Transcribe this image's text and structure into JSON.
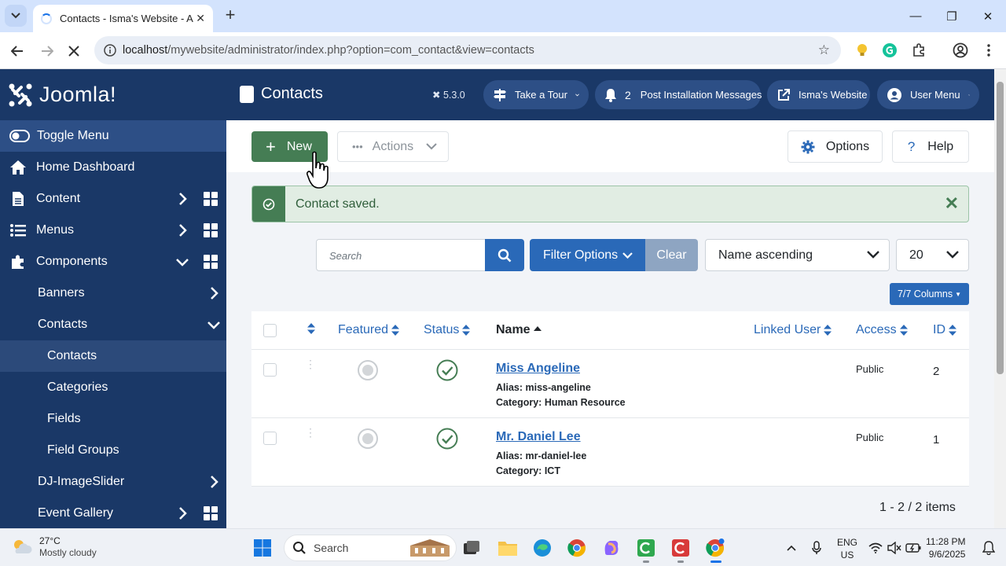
{
  "browser": {
    "tab_title": "Contacts - Isma's Website - Administration",
    "url_host": "localhost",
    "url_path": "/mywebsite/administrator/index.php?option=com_contact&view=contacts"
  },
  "sidebar": {
    "brand": "Joomla!",
    "toggle_label": "Toggle Menu",
    "items": [
      {
        "label": "Home Dashboard"
      },
      {
        "label": "Content"
      },
      {
        "label": "Menus"
      },
      {
        "label": "Components"
      },
      {
        "label": "Banners"
      },
      {
        "label": "Contacts"
      },
      {
        "label": "Contacts"
      },
      {
        "label": "Categories"
      },
      {
        "label": "Fields"
      },
      {
        "label": "Field Groups"
      },
      {
        "label": "DJ-ImageSlider"
      },
      {
        "label": "Event Gallery"
      }
    ]
  },
  "header": {
    "title": "Contacts",
    "version": "5.3.0",
    "tour_label": "Take a Tour",
    "messages_count": "2",
    "messages_label": "Post Installation Messages",
    "site_label": "Isma's Website",
    "user_label": "User Menu"
  },
  "toolbar": {
    "new_label": "New",
    "actions_label": "Actions",
    "options_label": "Options",
    "help_label": "Help"
  },
  "alert": {
    "message": "Contact saved."
  },
  "filters": {
    "search_placeholder": "Search",
    "filter_label": "Filter Options",
    "clear_label": "Clear",
    "sort_value": "Name ascending",
    "limit_value": "20",
    "columns_label": "7/7 Columns"
  },
  "table": {
    "headers": {
      "featured": "Featured",
      "status": "Status",
      "name": "Name",
      "linked_user": "Linked User",
      "access": "Access",
      "id": "ID"
    },
    "rows": [
      {
        "name": "Miss Angeline",
        "alias": "Alias: miss-angeline",
        "category": "Category: Human Resource",
        "access": "Public",
        "id": "2"
      },
      {
        "name": "Mr. Daniel Lee",
        "alias": "Alias: mr-daniel-lee",
        "category": "Category: ICT",
        "access": "Public",
        "id": "1"
      }
    ],
    "pagination": "1 - 2 / 2 items"
  },
  "taskbar": {
    "temperature": "27°C",
    "weather": "Mostly cloudy",
    "search_label": "Search",
    "language": "ENG",
    "region": "US",
    "time": "11:28 PM",
    "date": "9/6/2025"
  },
  "colors": {
    "sidebar_bg": "#1a3867",
    "primary": "#2a69b8",
    "success": "#457d54"
  }
}
